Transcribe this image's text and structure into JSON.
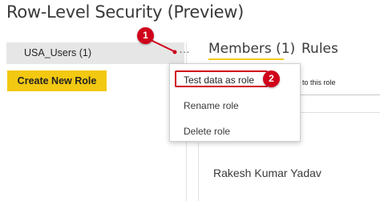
{
  "dialog": {
    "title": "Row-Level Security (Preview)"
  },
  "roles": {
    "items": [
      {
        "label": "USA_Users (1)",
        "more_icon": "ellipsis-icon"
      }
    ],
    "create_button_label": "Create New Role"
  },
  "tabs": [
    {
      "label": "Members (1)",
      "active": true
    },
    {
      "label": "Rules",
      "active": false
    }
  ],
  "members": {
    "assign_text_fragment": "to this role",
    "names": [
      "Rakesh Kumar Yadav"
    ]
  },
  "context_menu": {
    "items": [
      {
        "label": "Test data as role"
      },
      {
        "label": "Rename role"
      },
      {
        "label": "Delete role"
      }
    ]
  },
  "annotations": {
    "step1": "1",
    "step2": "2"
  },
  "colors": {
    "accent_yellow": "#f2c811",
    "annotation_red": "#d0021b",
    "role_item_bg": "#e6e6e6"
  }
}
